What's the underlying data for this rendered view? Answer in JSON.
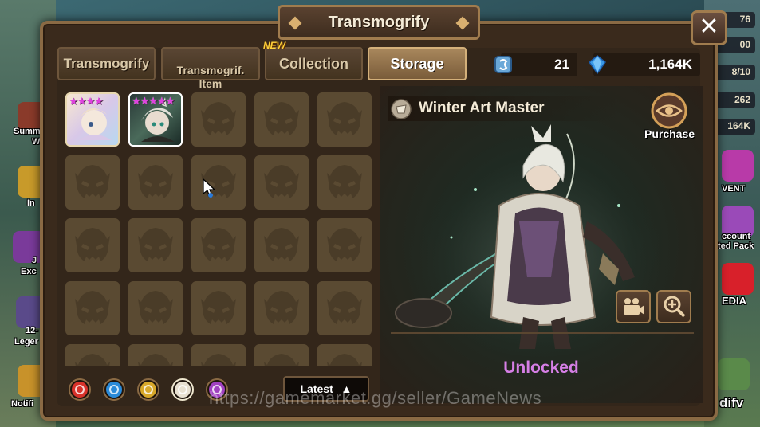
{
  "window": {
    "title": "Transmogrify",
    "close_symbol": "✕"
  },
  "tabs": [
    {
      "label": "Transmogrify",
      "active": false
    },
    {
      "label": "Transmogrif.\nItem",
      "active": false
    },
    {
      "label": "Collection",
      "active": false,
      "badge": "NEW"
    },
    {
      "label": "Storage",
      "active": true
    }
  ],
  "currencies": [
    {
      "icon": "transmog-stone-icon",
      "value": "21"
    },
    {
      "icon": "crystal-icon",
      "value": "1,164K"
    }
  ],
  "grid": {
    "rows": 5,
    "cols": 5,
    "filled": [
      {
        "index": 0,
        "stars": "★★★★",
        "name": "light-monster-portrait"
      },
      {
        "index": 1,
        "stars": "★★★★★",
        "name": "winter-art-master-portrait",
        "selected": true
      }
    ],
    "empty_icon": "monster-silhouette-icon"
  },
  "filters": [
    {
      "name": "fire-attribute-icon",
      "color": "#d8322a"
    },
    {
      "name": "water-attribute-icon",
      "color": "#2a8ad8"
    },
    {
      "name": "wind-attribute-icon",
      "color": "#d8a82a"
    },
    {
      "name": "light-attribute-icon",
      "color": "#e8e0d0",
      "selected": true
    },
    {
      "name": "dark-attribute-icon",
      "color": "#a040c0"
    }
  ],
  "sort": {
    "label": "Latest",
    "arrow": "▲"
  },
  "preview": {
    "name": "Winter Art Master",
    "purchase_label": "Purchase",
    "status": "Unlocked",
    "status_color": "#d67fe6",
    "buttons": [
      "video-camera-icon",
      "zoom-in-icon"
    ]
  },
  "watermark": "https://gamemarket.gg/seller/GameNews",
  "background": {
    "left_labels": [
      "Summ",
      "W",
      "In",
      "J",
      "Exc",
      "12-",
      "Leger",
      "Notifi"
    ],
    "right_stats": [
      "76",
      "00",
      "8/10",
      "262",
      "164K"
    ],
    "right_labels": [
      "VENT",
      "ccount",
      "ted Pack",
      "EDIA",
      "difv"
    ]
  }
}
